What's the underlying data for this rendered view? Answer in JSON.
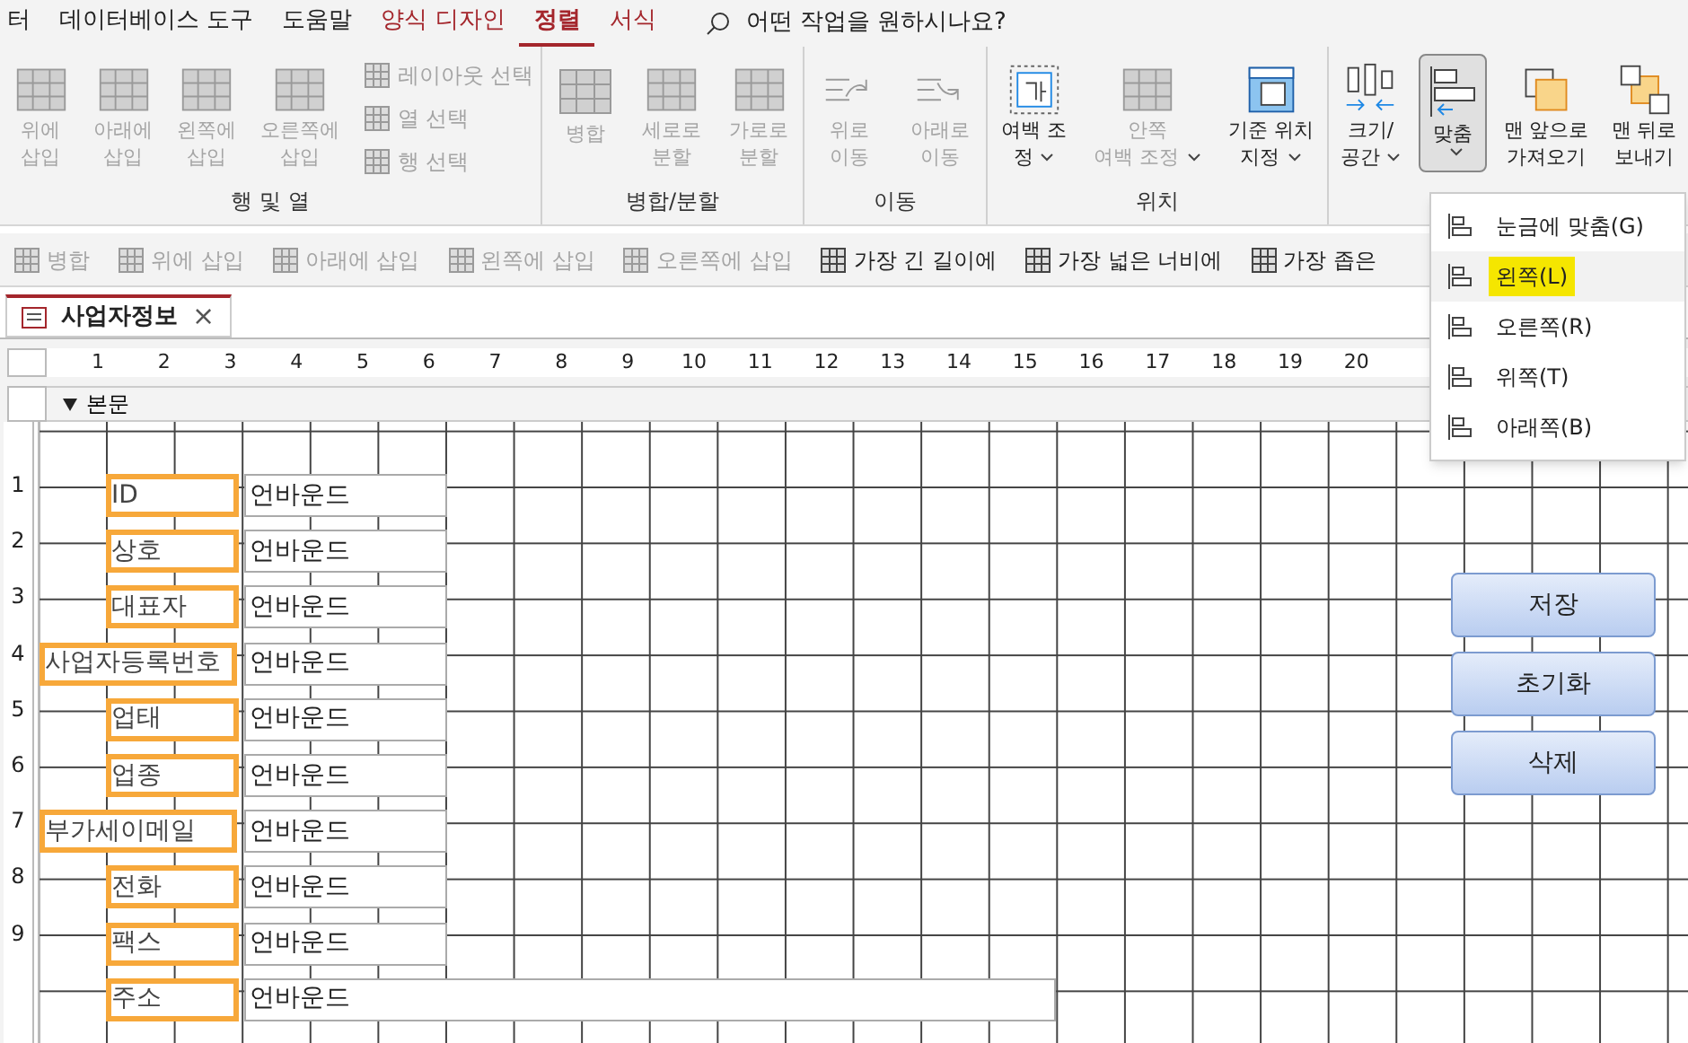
{
  "menu_tabs": [
    {
      "label": "터",
      "selected": false,
      "contextual": false
    },
    {
      "label": "데이터베이스 도구",
      "selected": false,
      "contextual": false
    },
    {
      "label": "도움말",
      "selected": false,
      "contextual": false
    },
    {
      "label": "양식 디자인",
      "selected": false,
      "contextual": true
    },
    {
      "label": "정렬",
      "selected": true,
      "contextual": true
    },
    {
      "label": "서식",
      "selected": false,
      "contextual": true
    }
  ],
  "tell_me": {
    "placeholder": "어떤 작업을 원하시나요?"
  },
  "ribbon": {
    "groups": [
      {
        "label": "행 및 열",
        "large": [
          {
            "lines": [
              "위에",
              "삽입"
            ],
            "disabled": true,
            "dropdown": false,
            "pressed": false
          },
          {
            "lines": [
              "아래에",
              "삽입"
            ],
            "disabled": true,
            "dropdown": false,
            "pressed": false
          },
          {
            "lines": [
              "왼쪽에",
              "삽입"
            ],
            "disabled": true,
            "dropdown": false,
            "pressed": false
          },
          {
            "lines": [
              "오른쪽에",
              "삽입"
            ],
            "disabled": true,
            "dropdown": false,
            "pressed": false
          }
        ],
        "small": [
          {
            "label": "레이아웃 선택",
            "disabled": true
          },
          {
            "label": "열 선택",
            "disabled": true
          },
          {
            "label": "행 선택",
            "disabled": true
          }
        ]
      },
      {
        "label": "병합/분할",
        "large": [
          {
            "lines": [
              "병합"
            ],
            "disabled": true,
            "dropdown": false,
            "pressed": false
          },
          {
            "lines": [
              "세로로",
              "분할"
            ],
            "disabled": true,
            "dropdown": false,
            "pressed": false
          },
          {
            "lines": [
              "가로로",
              "분할"
            ],
            "disabled": true,
            "dropdown": false,
            "pressed": false
          }
        ]
      },
      {
        "label": "이동",
        "large": [
          {
            "lines": [
              "위로",
              "이동"
            ],
            "disabled": true,
            "dropdown": false,
            "pressed": false
          },
          {
            "lines": [
              "아래로",
              "이동"
            ],
            "disabled": true,
            "dropdown": false,
            "pressed": false
          }
        ]
      },
      {
        "label": "위치",
        "large": [
          {
            "lines": [
              "여백 조",
              "정"
            ],
            "disabled": false,
            "dropdown": true,
            "pressed": false
          },
          {
            "lines": [
              "안쪽",
              "여백 조정"
            ],
            "disabled": true,
            "dropdown": true,
            "pressed": false
          },
          {
            "lines": [
              "기준 위치",
              "지정"
            ],
            "disabled": false,
            "dropdown": true,
            "pressed": false
          }
        ]
      },
      {
        "large": [
          {
            "lines": [
              "크기/",
              "공간"
            ],
            "disabled": false,
            "dropdown": true,
            "pressed": false
          },
          {
            "lines": [
              "맞춤"
            ],
            "disabled": false,
            "dropdown": true,
            "pressed": true
          },
          {
            "lines": [
              "맨 앞으로",
              "가져오기"
            ],
            "disabled": false,
            "dropdown": false,
            "pressed": false
          },
          {
            "lines": [
              "맨 뒤로",
              "보내기"
            ],
            "disabled": false,
            "dropdown": false,
            "pressed": false
          }
        ]
      }
    ]
  },
  "quick_toolbar": [
    {
      "label": "병합",
      "disabled": true
    },
    {
      "label": "위에 삽입",
      "disabled": true
    },
    {
      "label": "아래에 삽입",
      "disabled": true
    },
    {
      "label": "왼쪽에 삽입",
      "disabled": true
    },
    {
      "label": "오른쪽에 삽입",
      "disabled": true
    },
    {
      "label": "가장 긴 길이에",
      "disabled": false
    },
    {
      "label": "가장 넓은 너비에",
      "disabled": false
    },
    {
      "label": "가장 좁은",
      "disabled": false
    }
  ],
  "document_tab": {
    "title": "사업자정보",
    "close": "×"
  },
  "ruler": {
    "horizontal": [
      "1",
      "2",
      "3",
      "4",
      "5",
      "6",
      "7",
      "8",
      "9",
      "10",
      "11",
      "12",
      "13",
      "14",
      "15",
      "16",
      "17",
      "18",
      "19",
      "20"
    ],
    "vertical": [
      "1",
      "2",
      "3",
      "4",
      "5",
      "6",
      "7",
      "8",
      "9"
    ]
  },
  "section": {
    "title": "본문"
  },
  "fields": [
    {
      "label": {
        "text": "ID",
        "kind": "short",
        "selected": true
      },
      "textbox": {
        "text": "언바운드",
        "kind": "short"
      }
    },
    {
      "label": {
        "text": "상호",
        "kind": "short",
        "selected": true
      },
      "textbox": {
        "text": "언바운드",
        "kind": "short"
      }
    },
    {
      "label": {
        "text": "대표자",
        "kind": "short",
        "selected": true
      },
      "textbox": {
        "text": "언바운드",
        "kind": "short"
      }
    },
    {
      "label": {
        "text": "사업자등록번호",
        "kind": "wide",
        "selected": true
      },
      "textbox": {
        "text": "언바운드",
        "kind": "short"
      }
    },
    {
      "label": {
        "text": "업태",
        "kind": "short",
        "selected": true
      },
      "textbox": {
        "text": "언바운드",
        "kind": "short"
      }
    },
    {
      "label": {
        "text": "업종",
        "kind": "short",
        "selected": true
      },
      "textbox": {
        "text": "언바운드",
        "kind": "short"
      }
    },
    {
      "label": {
        "text": "부가세이메일",
        "kind": "wide",
        "selected": true
      },
      "textbox": {
        "text": "언바운드",
        "kind": "short"
      }
    },
    {
      "label": {
        "text": "전화",
        "kind": "short",
        "selected": true
      },
      "textbox": {
        "text": "언바운드",
        "kind": "short"
      }
    },
    {
      "label": {
        "text": "팩스",
        "kind": "short",
        "selected": true
      },
      "textbox": {
        "text": "언바운드",
        "kind": "short"
      }
    },
    {
      "label": {
        "text": "주소",
        "kind": "short",
        "selected": true
      },
      "textbox": {
        "text": "언바운드",
        "kind": "long"
      }
    }
  ],
  "form_buttons": [
    "저장",
    "초기화",
    "삭제"
  ],
  "align_menu": [
    {
      "label": "눈금에 맞춤(G)",
      "selected": false
    },
    {
      "label": "왼쪽(L)",
      "selected": true
    },
    {
      "label": "오른쪽(R)",
      "selected": false
    },
    {
      "label": "위쪽(T)",
      "selected": false
    },
    {
      "label": "아래쪽(B)",
      "selected": false
    }
  ]
}
